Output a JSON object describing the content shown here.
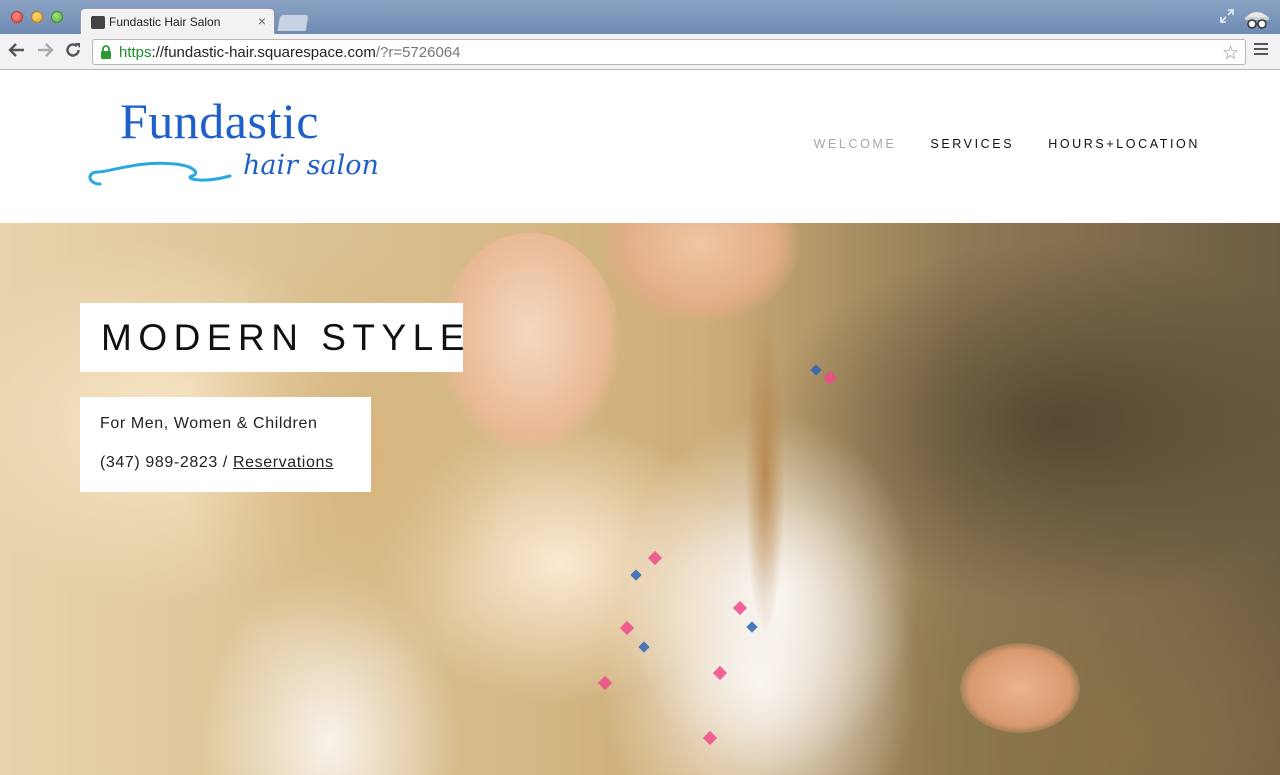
{
  "browser": {
    "tab_title": "Fundastic Hair Salon",
    "tab_close": "×",
    "url_scheme": "https",
    "url_host": "://fundastic-hair.squarespace.com",
    "url_path": "/?r=5726064"
  },
  "site": {
    "logo_main": "Fundastic",
    "logo_sub": "hair salon",
    "brand_color": "#1e5fc8",
    "swoosh_color": "#29a9e0",
    "nav": [
      {
        "label": "WELCOME",
        "active": true
      },
      {
        "label": "SERVICES",
        "active": false
      },
      {
        "label": "HOURS+LOCATION",
        "active": false
      }
    ]
  },
  "hero": {
    "title": "MODERN STYLE",
    "line1": "For Men, Women & Children",
    "phone": "(347) 989-2823",
    "separator": " / ",
    "reservations_label": "Reservations"
  },
  "icons": {
    "back": "back-arrow-icon",
    "forward": "forward-arrow-icon",
    "reload": "reload-icon",
    "lock": "lock-icon",
    "star": "bookmark-star-icon",
    "menu": "hamburger-menu-icon"
  }
}
